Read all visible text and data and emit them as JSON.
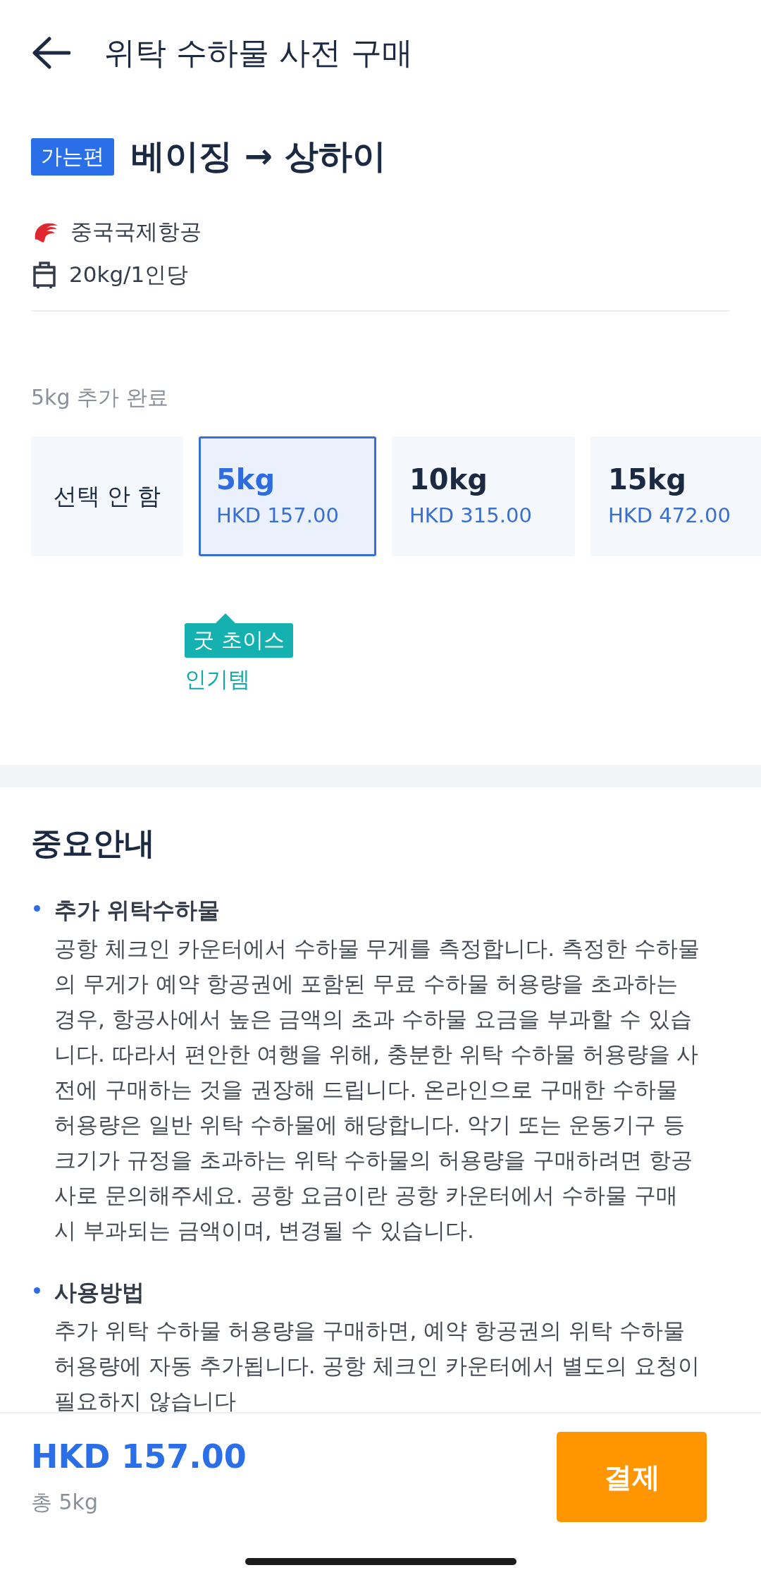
{
  "header": {
    "title": "위탁 수하물 사전 구매"
  },
  "flight": {
    "badge": "가는편",
    "route": "베이징 → 상하이",
    "airline": "중국국제항공",
    "allowance": "20kg/1인당"
  },
  "status": "5kg 추가 완료",
  "options": [
    {
      "kind": "none",
      "label": "선택 안 함",
      "selected": false
    },
    {
      "kind": "weight",
      "weight": "5kg",
      "price": "HKD 157.00",
      "selected": true,
      "badge": "굿 초이스",
      "caption": "인기템"
    },
    {
      "kind": "weight",
      "weight": "10kg",
      "price": "HKD 315.00",
      "selected": false
    },
    {
      "kind": "weight",
      "weight": "15kg",
      "price": "HKD 472.00",
      "selected": false
    }
  ],
  "notice": {
    "title": "중요안내",
    "items": [
      {
        "heading": "추가 위탁수하물",
        "text": "공항 체크인 카운터에서 수하물 무게를 측정합니다. 측정한 수하물의 무게가 예약 항공권에 포함된 무료 수하물 허용량을 초과하는 경우, 항공사에서 높은 금액의 초과 수하물 요금을 부과할 수 있습니다. 따라서 편안한 여행을 위해, 충분한 위탁 수하물 허용량을 사전에 구매하는 것을 권장해 드립니다. 온라인으로 구매한 수하물 허용량은 일반 위탁 수하물에 해당합니다. 악기 또는 운동기구 등 크기가 규정을 초과하는 위탁 수하물의 허용량을 구매하려면 항공사로 문의해주세요. 공항 요금이란 공항 카운터에서 수하물 구매 시 부과되는 금액이며, 변경될 수 있습니다."
      },
      {
        "heading": "사용방법",
        "text": "추가 위탁 수하물 허용량을 구매하면, 예약 항공권의 위탁 수하물 허용량에 자동 추가됩니다. 공항 체크인 카운터에서 별도의 요청이 필요하지 않습니다"
      }
    ]
  },
  "footer": {
    "total_price": "HKD 157.00",
    "total_weight": "총 5kg",
    "pay_button": "결제"
  }
}
